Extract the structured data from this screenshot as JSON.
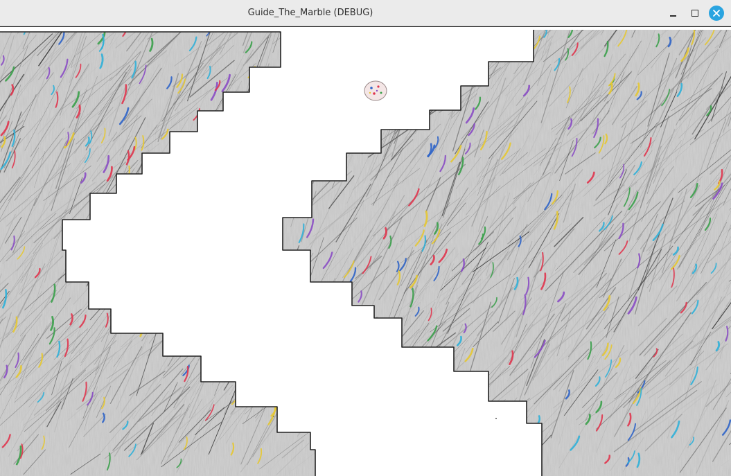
{
  "window": {
    "title": "Guide_The_Marble (DEBUG)",
    "close_color": "#2aa4e0"
  },
  "controls": {
    "minimize_icon": "minimize-icon",
    "maximize_icon": "maximize-icon",
    "close_icon": "close-icon"
  },
  "game": {
    "wall_color": "#c9c9c9",
    "wall_outline_color": "#222222",
    "marble_color": "#f2dede",
    "stroke_colors": [
      "#e0354e",
      "#2f64c8",
      "#3aa04a",
      "#e6c832",
      "#8a4cc4",
      "#30b0d8"
    ]
  }
}
